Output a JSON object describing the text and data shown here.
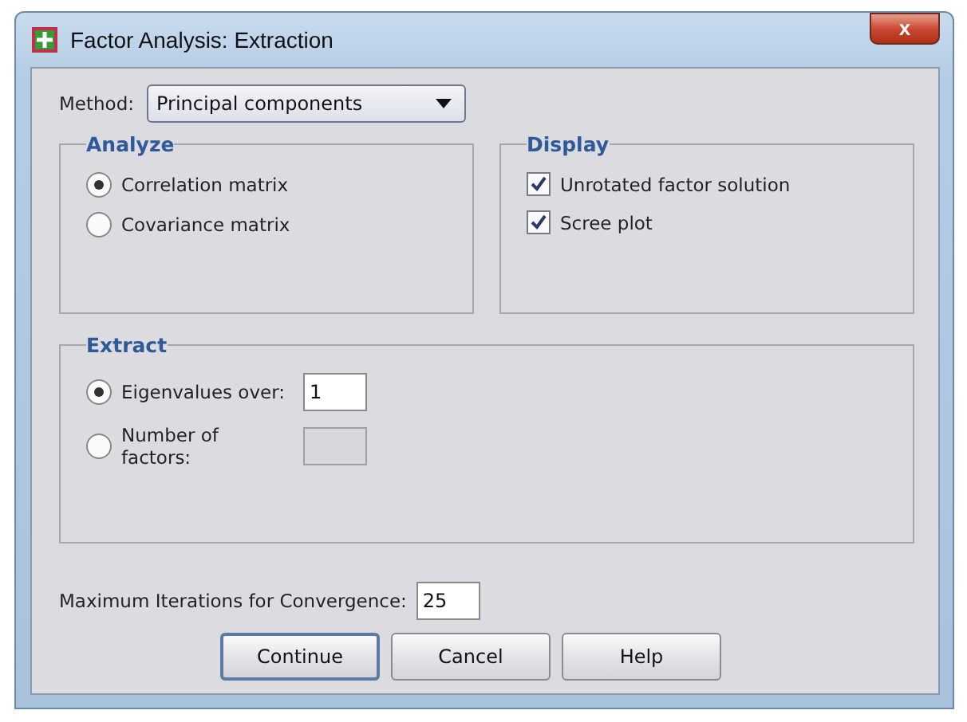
{
  "window": {
    "title": "Factor Analysis: Extraction",
    "close": "x"
  },
  "method": {
    "label": "Method:",
    "value": "Principal components"
  },
  "analyze": {
    "title": "Analyze",
    "options": [
      {
        "label": "Correlation matrix",
        "selected": true
      },
      {
        "label": "Covariance matrix",
        "selected": false
      }
    ]
  },
  "display": {
    "title": "Display",
    "options": [
      {
        "label": "Unrotated factor solution",
        "checked": true
      },
      {
        "label": "Scree plot",
        "checked": true
      }
    ]
  },
  "extract": {
    "title": "Extract",
    "options": [
      {
        "label": "Eigenvalues over:",
        "selected": true,
        "value": "1",
        "disabled": false
      },
      {
        "label": "Number of factors:",
        "selected": false,
        "disabled": true
      }
    ]
  },
  "iterations": {
    "label": "Maximum Iterations for Convergence:",
    "value": "25"
  },
  "buttons": [
    {
      "label": "Continue",
      "default": true
    },
    {
      "label": "Cancel",
      "default": false
    },
    {
      "label": "Help",
      "default": false
    }
  ]
}
